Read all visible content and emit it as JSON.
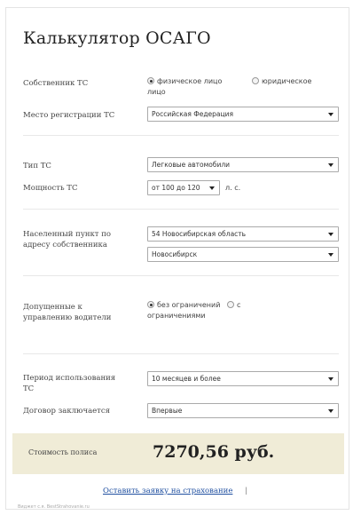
{
  "title": "Калькулятор ОСАГО",
  "owner": {
    "label": "Собственник ТС",
    "options": [
      "физическое лицо",
      "юридическое лицо"
    ],
    "selected": "физическое лицо"
  },
  "registration": {
    "label": "Место регистрации ТС",
    "value": "Российская Федерация"
  },
  "vehicle_type": {
    "label": "Тип ТС",
    "value": "Легковые автомобили"
  },
  "power": {
    "label": "Мощность ТС",
    "value": "от 100 до 120",
    "unit": "л. с."
  },
  "location": {
    "label": "Населенный пункт по адресу собственника",
    "region": "54 Новосибирская область",
    "city": "Новосибирск"
  },
  "drivers": {
    "label": "Допущенные к управлению водители",
    "options": [
      "без ограничений",
      "с ограничениями"
    ],
    "selected": "без ограничений"
  },
  "period": {
    "label": "Период использования ТС",
    "value": "10 месяцев и более"
  },
  "contract": {
    "label": "Договор заключается",
    "value": "Впервые"
  },
  "price": {
    "label": "Стоимость полиса",
    "value": "7270,56 руб."
  },
  "order": {
    "link_text": "Оставить заявку на страхование",
    "separator": "|"
  },
  "footer_text": "Виджет с.я. BestStrahovanie.ru"
}
